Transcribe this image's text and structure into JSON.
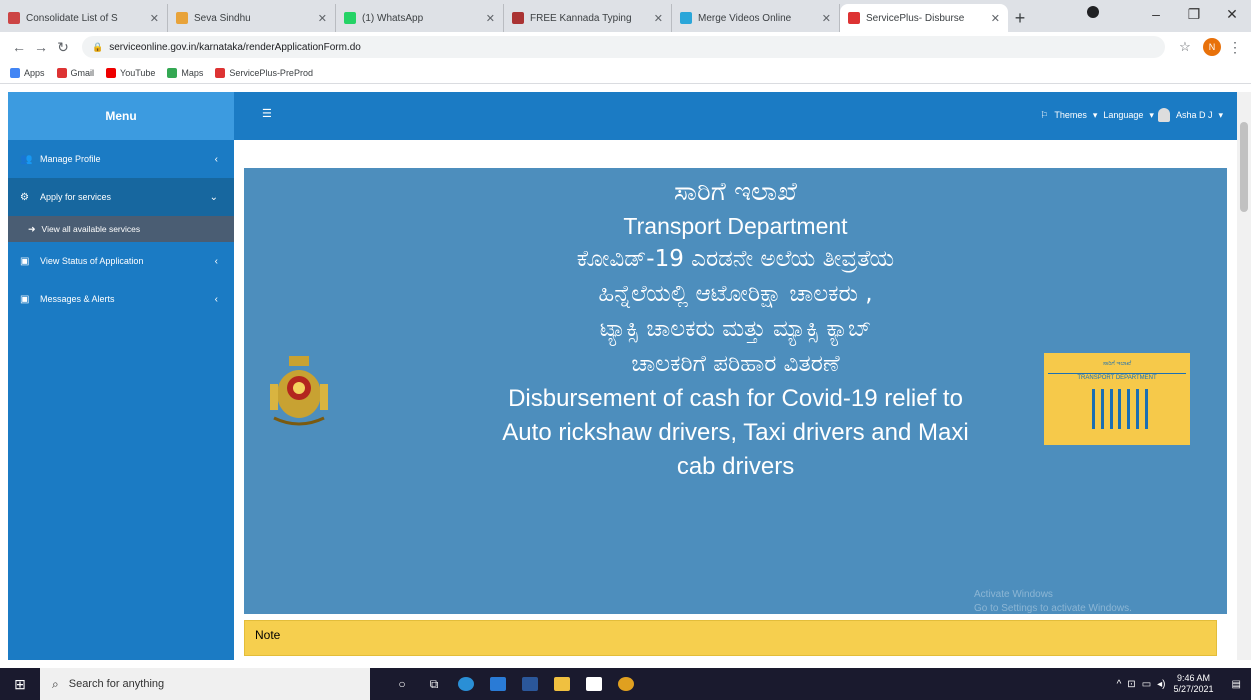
{
  "browser": {
    "tabs": [
      {
        "title": "Consolidate List of S",
        "color": "#c44"
      },
      {
        "title": "Seva Sindhu",
        "color": "#e8a33a"
      },
      {
        "title": "(1) WhatsApp",
        "color": "#25d366"
      },
      {
        "title": "FREE Kannada Typing",
        "color": "#a33"
      },
      {
        "title": "Merge Videos Online",
        "color": "#2aa6d9"
      },
      {
        "title": "ServicePlus- Disburse",
        "color": "#d33",
        "active": true
      }
    ],
    "address": "serviceonline.gov.in/karnataka/renderApplicationForm.do",
    "profile_initial": "N",
    "bookmarks": [
      {
        "label": "Apps",
        "color": "#4285f4"
      },
      {
        "label": "Gmail",
        "color": "#d33"
      },
      {
        "label": "YouTube",
        "color": "#e00"
      },
      {
        "label": "Maps",
        "color": "#34a853"
      },
      {
        "label": "ServicePlus-PreProd",
        "color": "#d33"
      }
    ]
  },
  "app": {
    "menu_title": "Menu",
    "menu_items": [
      {
        "label": "Manage Profile",
        "icon": "users-icon"
      },
      {
        "label": "Apply for services",
        "icon": "cogs-icon",
        "open": true
      },
      {
        "label": "View Status of Application",
        "icon": "list-icon"
      },
      {
        "label": "Messages & Alerts",
        "icon": "list-icon"
      }
    ],
    "submenu_label": "View all available services",
    "topbar": {
      "themes": "Themes",
      "language": "Language",
      "user": "Asha D J"
    }
  },
  "banner": {
    "kn_title": "ಸಾರಿಗೆ ಇಲಾಖೆ",
    "en_title": "Transport Department",
    "kn_lines": [
      "ಕೋವಿಡ್-19 ಎರಡನೇ ಅಲೆಯ ತೀವ್ರತೆಯ",
      "ಹಿನ್ನೆಲೆಯಲ್ಲಿ ಆಟೋರಿಕ್ಷಾ ಚಾಲಕರು ,",
      "ಟ್ಯಾಕ್ಸಿ ಚಾಲಕರು ಮತ್ತು ಮ್ಯಾಕ್ಸಿ ಕ್ಯಾಬ್",
      "ಚಾಲಕರಿಗೆ ಪರಿಹಾರ ವಿತರಣೆ"
    ],
    "en_lines": [
      "Disbursement of cash for Covid-19 relief to",
      "Auto rickshaw drivers, Taxi drivers and Maxi",
      "cab drivers"
    ],
    "logo_kn": "ಸಾರಿಗೆ ಇಲಾಖೆ",
    "logo_en": "TRANSPORT DEPARTMENT"
  },
  "note_label": "Note",
  "watermark": [
    "Activate Windows",
    "Go to Settings to activate Windows."
  ],
  "taskbar": {
    "search_placeholder": "Search for anything",
    "time": "9:46 AM",
    "date": "5/27/2021"
  }
}
